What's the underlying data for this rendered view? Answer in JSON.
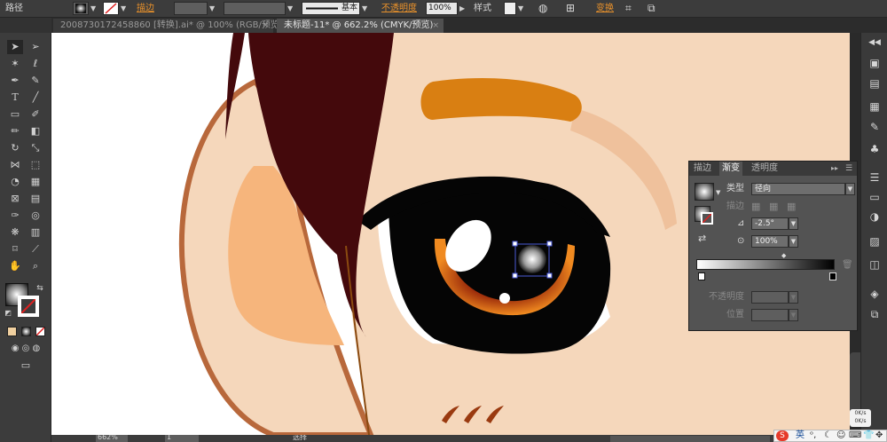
{
  "control_bar": {
    "object_type": "路径",
    "stroke_label": "描边",
    "brush_label": "基本",
    "opacity_label": "不透明度",
    "opacity_value": "100%",
    "style_label": "样式",
    "transform_label": "变换"
  },
  "tabs": [
    {
      "label": "2008730172458860 [转换].ai* @ 100% (RGB/预览)",
      "active": false
    },
    {
      "label": "未标题-11* @ 662.2% (CMYK/预览)",
      "active": true
    }
  ],
  "gradient_panel": {
    "tabs": [
      "描边",
      "渐变",
      "透明度"
    ],
    "active_tab": "渐变",
    "type_label": "类型",
    "type_value": "径向",
    "stroke_label": "描边",
    "angle_value": "-2.5°",
    "aspect_value": "100%",
    "opacity_label": "不透明度",
    "location_label": "位置"
  },
  "status_bar": {
    "zoom_value": "662%",
    "page_value": "1",
    "mode_label": "选择"
  },
  "colors": {
    "skin": "#f5d7bb",
    "ear_outline": "#b8683b",
    "ear_inner": "#f6b57c",
    "hair": "#44090c",
    "eyebrow": "#d97f12",
    "accent_orange": "#e8912b"
  },
  "taskbar": {
    "ime_label": "英",
    "speed_up": "0K/s",
    "speed_down": "0K/s"
  }
}
